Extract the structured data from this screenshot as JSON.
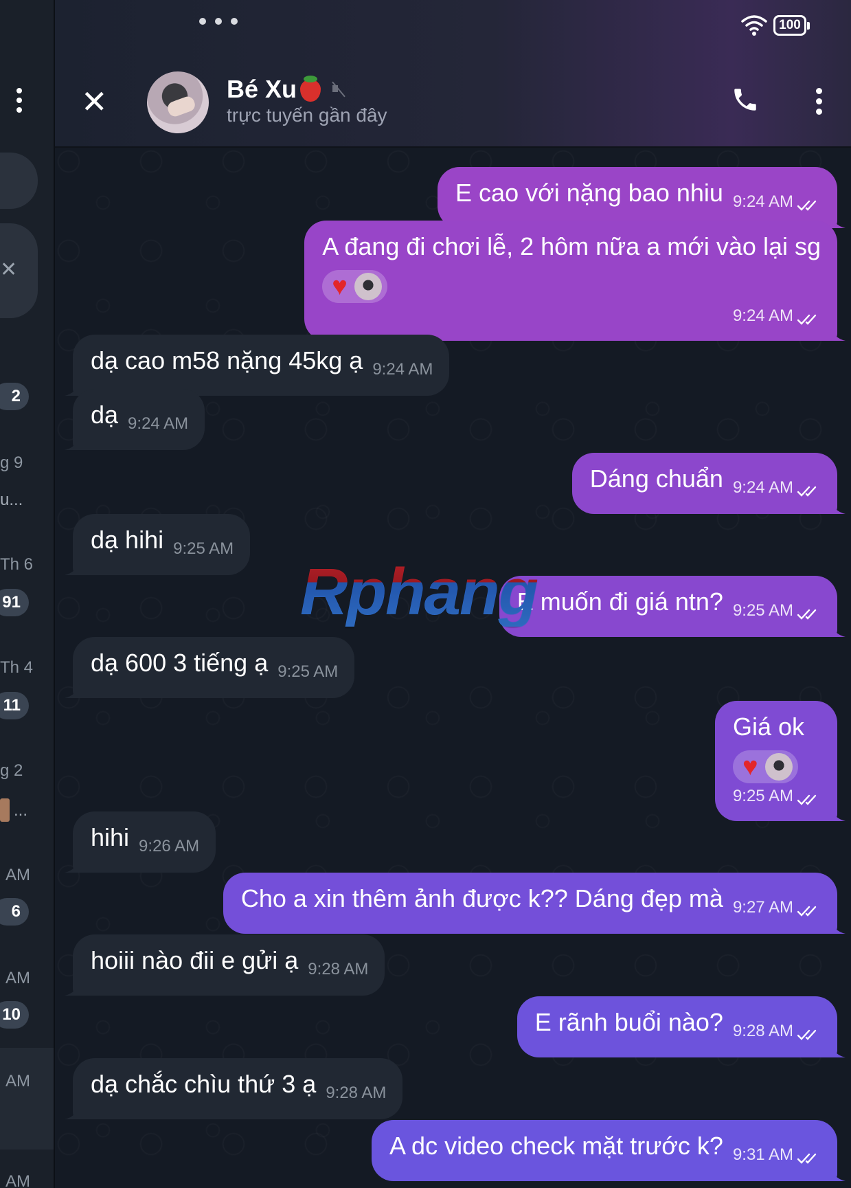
{
  "left_pane": {
    "badges": [
      "2",
      "91",
      "11",
      "6",
      "10"
    ],
    "texts": [
      "g 9",
      "u...",
      "Th 6",
      "Th 4",
      "g 2",
      "...",
      "AM",
      "AM",
      "AM",
      "AM"
    ]
  },
  "status_bar": {
    "battery": "100"
  },
  "header": {
    "contact_name": "Bé Xu",
    "contact_status": "trực tuyến gần đây"
  },
  "messages": [
    {
      "dir": "out",
      "text": "E cao với nặng bao nhiu",
      "time": "9:24 AM",
      "color": "#9a45c7"
    },
    {
      "dir": "out",
      "text": "A đang đi chơi lễ, 2 hôm nữa a mới vào lại sg",
      "time": "9:24 AM",
      "reactions": true,
      "color": "#9845c8"
    },
    {
      "dir": "in",
      "text": "dạ cao m58 nặng 45kg ạ",
      "time": "9:24 AM"
    },
    {
      "dir": "in",
      "text": "dạ",
      "time": "9:24 AM"
    },
    {
      "dir": "out",
      "text": "Dáng chuẩn",
      "time": "9:24 AM",
      "color": "#8c47cc"
    },
    {
      "dir": "in",
      "text": "dạ hihi",
      "time": "9:25 AM"
    },
    {
      "dir": "out",
      "text": "E muốn đi giá ntn?",
      "time": "9:25 AM",
      "color": "#8848cf"
    },
    {
      "dir": "in",
      "text": "dạ 600 3 tiếng ạ",
      "time": "9:25 AM"
    },
    {
      "dir": "out",
      "text": "Giá ok",
      "time": "9:25 AM",
      "reactions": true,
      "color": "#7f4bd3"
    },
    {
      "dir": "in",
      "text": "hihi",
      "time": "9:26 AM"
    },
    {
      "dir": "out",
      "text": "Cho a xin thêm ảnh được k?? Dáng đẹp mà",
      "time": "9:27 AM",
      "color": "#744fd9"
    },
    {
      "dir": "in",
      "text": "hoiii nào đii e gửi ạ",
      "time": "9:28 AM"
    },
    {
      "dir": "out",
      "text": "E rãnh buổi nào?",
      "time": "9:28 AM",
      "color": "#6d53dc"
    },
    {
      "dir": "in",
      "text": "dạ chắc chìu thứ 3 ạ",
      "time": "9:28 AM"
    },
    {
      "dir": "out",
      "text": "A dc video check mặt trước k?",
      "time": "9:31 AM",
      "color": "#6a55de"
    }
  ],
  "watermark": "Rphang",
  "colors": {
    "incoming_bubble": "#212833",
    "background": "#141a24",
    "heart": "#e3262a"
  },
  "icons": [
    "close-icon",
    "strawberry-icon",
    "mute-icon",
    "phone-icon",
    "menu-icon",
    "wifi-icon",
    "battery-icon",
    "double-check-icon",
    "heart-icon"
  ]
}
